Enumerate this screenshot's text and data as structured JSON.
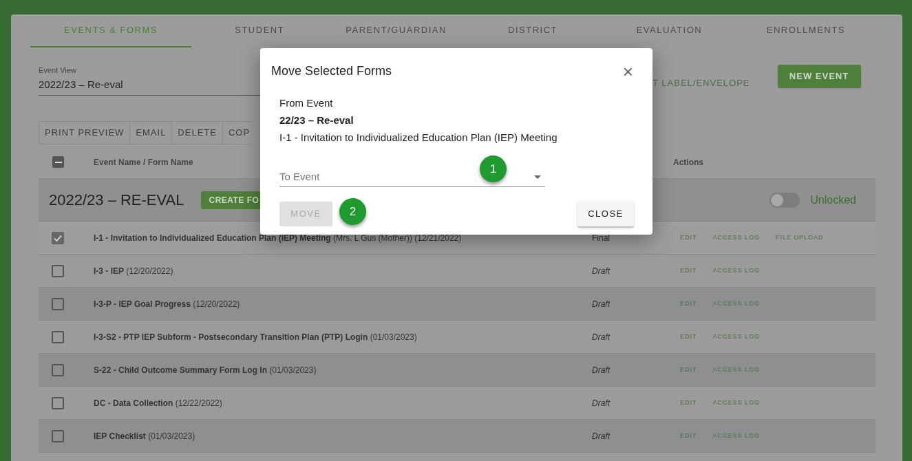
{
  "tabs": [
    {
      "label": "EVENTS & FORMS",
      "selected": true
    },
    {
      "label": "STUDENT",
      "selected": false
    },
    {
      "label": "PARENT/GUARDIAN",
      "selected": false
    },
    {
      "label": "DISTRICT",
      "selected": false
    },
    {
      "label": "EVALUATION",
      "selected": false
    },
    {
      "label": "ENROLLMENTS",
      "selected": false
    }
  ],
  "event_view": {
    "label": "Event View",
    "value": "2022/23 – Re-eval"
  },
  "print_label_link": "T LABEL/ENVELOPE",
  "new_event_button": "NEW EVENT",
  "toolbar": [
    "PRINT PREVIEW",
    "EMAIL",
    "DELETE",
    "COP"
  ],
  "table": {
    "header_checkbox": {
      "indeterminate": true
    },
    "columns": [
      "Event Name / Form Name",
      "Actions"
    ],
    "group": {
      "title": "2022/23 – RE-EVAL",
      "create_button": "CREATE FO",
      "lock_toggle": {
        "on": false,
        "label": "Unlocked"
      }
    },
    "rows": [
      {
        "name": "**I-1 - Invitation to Individualized Education Plan (IEP) Meeting** (Mrs. L Gus (Mother)) (12/21/2022)",
        "status": "Final",
        "kind": "final",
        "checked": true,
        "actions": [
          "EDIT",
          "ACCESS LOG",
          "FILE UPLOAD"
        ]
      },
      {
        "name": "**I-3 - IEP** (12/20/2022)",
        "status": "Draft",
        "kind": "draft",
        "checked": false,
        "actions": [
          "EDIT",
          "ACCESS LOG"
        ]
      },
      {
        "name": "**I-3-P - IEP Goal Progress** (12/20/2022)",
        "status": "Draft",
        "kind": "draft",
        "checked": false,
        "actions": [
          "EDIT",
          "ACCESS LOG"
        ]
      },
      {
        "name": "**I-3-S2 - PTP IEP Subform - Postsecondary Transition Plan (PTP) Login** (01/03/2023)",
        "status": "Draft",
        "kind": "draft",
        "checked": false,
        "actions": [
          "EDIT",
          "ACCESS LOG"
        ]
      },
      {
        "name": "**S-22 - Child Outcome Summary Form Log In** (01/03/2023)",
        "status": "Draft",
        "kind": "draft",
        "checked": false,
        "actions": [
          "EDIT",
          "ACCESS LOG"
        ]
      },
      {
        "name": "**DC - Data Collection** (12/22/2022)",
        "status": "Draft",
        "kind": "draft",
        "checked": false,
        "actions": [
          "EDIT",
          "ACCESS LOG"
        ]
      },
      {
        "name": "**IEP Checklist** (01/03/2023)",
        "status": "Draft",
        "kind": "draft",
        "checked": false,
        "actions": [
          "EDIT",
          "ACCESS LOG"
        ]
      }
    ]
  },
  "dialog": {
    "title": "Move Selected Forms",
    "close_icon": "×",
    "from_label": "From Event",
    "from_event": "22/23 – Re-eval",
    "form_name": "I-1 - Invitation to Individualized Education Plan (IEP) Meeting",
    "to_event": {
      "placeholder": "To Event"
    },
    "move_button": {
      "label": "MOVE",
      "disabled": true
    },
    "close_button": "CLOSE"
  },
  "callouts": [
    {
      "label": "1"
    },
    {
      "label": "2"
    }
  ]
}
